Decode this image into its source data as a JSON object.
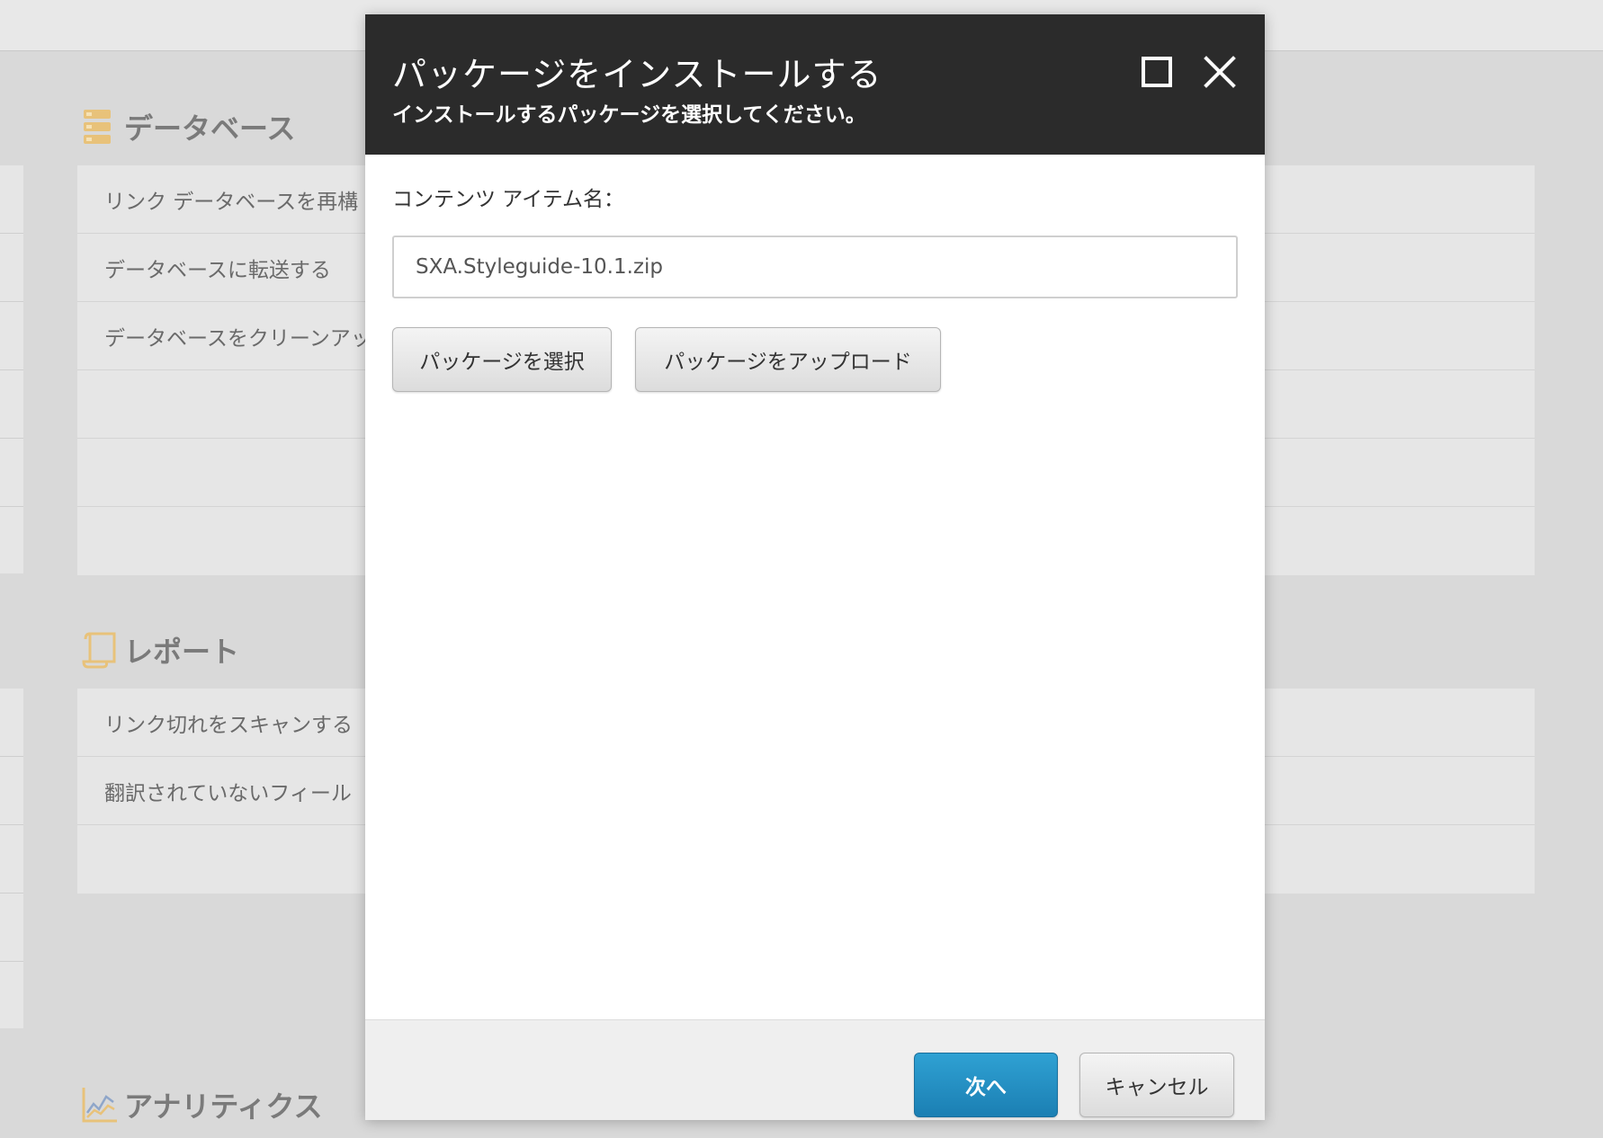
{
  "background": {
    "sections": [
      {
        "title": "データベース",
        "icon": "database-icon",
        "items": [
          "リンク データベースを再構",
          "データベースに転送する",
          "データベースをクリーンアッ"
        ]
      },
      {
        "title": "レポート",
        "icon": "report-scroll-icon",
        "items": [
          "リンク切れをスキャンする",
          "翻訳されていないフィール"
        ]
      },
      {
        "title": "アナリティクス",
        "icon": "analytics-chart-icon"
      }
    ]
  },
  "dialog": {
    "title": "パッケージをインストールする",
    "subtitle": "インストールするパッケージを選択してください。",
    "field_label": "コンテンツ アイテム名：",
    "package_value": "SXA.Styleguide-10.1.zip",
    "select_button": "パッケージを選択",
    "upload_button": "パッケージをアップロード",
    "next_button": "次へ",
    "cancel_button": "キャンセル"
  },
  "colors": {
    "header_bg": "#2b2b2b",
    "primary_button": "#2391c5",
    "section_icon": "#e8c27a",
    "overlay_bg": "#d9d9d9"
  }
}
